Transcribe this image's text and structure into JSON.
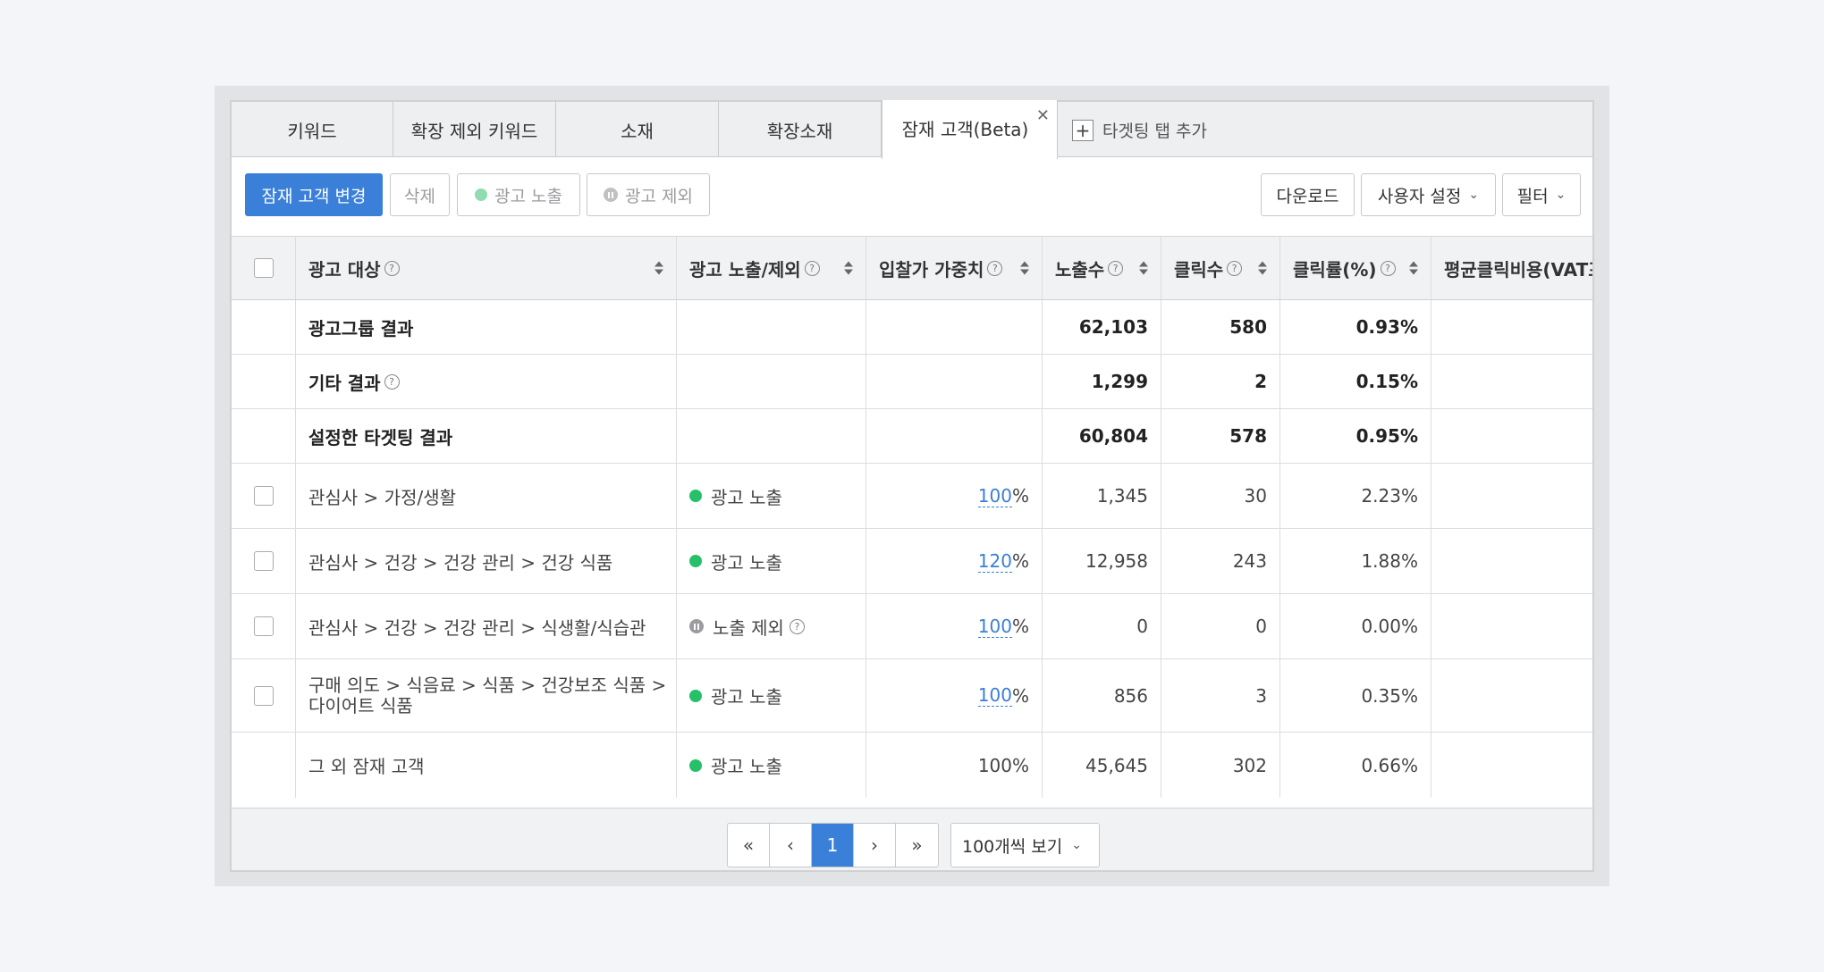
{
  "tabs": [
    {
      "label": "키워드"
    },
    {
      "label": "확장 제외 키워드"
    },
    {
      "label": "소재"
    },
    {
      "label": "확장소재"
    },
    {
      "label": "잠재 고객(Beta)"
    }
  ],
  "add_tab_label": "타겟팅 탭 추가",
  "toolbar": {
    "change_label": "잠재 고객 변경",
    "delete_label": "삭제",
    "show_label": "광고 노출",
    "exclude_label": "광고 제외",
    "download_label": "다운로드",
    "user_settings_label": "사용자 설정",
    "filter_label": "필터"
  },
  "columns": [
    "광고 대상",
    "광고 노출/제외",
    "입찰가 가중치",
    "노출수",
    "클릭수",
    "클릭률(%)",
    "평균클릭비용(VAT포함"
  ],
  "summary_rows": [
    {
      "target": "광고그룹 결과",
      "impressions": "62,103",
      "clicks": "580",
      "ctr": "0.93%"
    },
    {
      "target": "기타 결과",
      "impressions": "1,299",
      "clicks": "2",
      "ctr": "0.15%"
    },
    {
      "target": "설정한 타겟팅 결과",
      "impressions": "60,804",
      "clicks": "578",
      "ctr": "0.95%"
    }
  ],
  "rows": [
    {
      "target": "관심사 > 가정/생활",
      "status": "광고 노출",
      "bid": "100",
      "impressions": "1,345",
      "clicks": "30",
      "ctr": "2.23%"
    },
    {
      "target": "관심사 > 건강 > 건강 관리 > 건강 식품",
      "status": "광고 노출",
      "bid": "120",
      "impressions": "12,958",
      "clicks": "243",
      "ctr": "1.88%"
    },
    {
      "target": "관심사 > 건강 > 건강 관리 > 식생활/식습관",
      "status": "노출 제외",
      "bid": "100",
      "impressions": "0",
      "clicks": "0",
      "ctr": "0.00%"
    },
    {
      "target": "구매 의도 > 식음료 > 식품 > 건강보조 식품 >",
      "target2": "다이어트 식품",
      "status": "광고 노출",
      "bid": "100",
      "impressions": "856",
      "clicks": "3",
      "ctr": "0.35%"
    },
    {
      "target": "그 외 잠재 고객",
      "status": "광고 노출",
      "bid": "100%",
      "impressions": "45,645",
      "clicks": "302",
      "ctr": "0.66%"
    }
  ],
  "percent_sign": "%",
  "pagination": {
    "first": "«",
    "prev": "‹",
    "current": "1",
    "next": "›",
    "last": "»",
    "per_page": "100개씩 보기"
  },
  "colors": {
    "primary": "#3a7fd8",
    "status_green": "#27c06a"
  }
}
